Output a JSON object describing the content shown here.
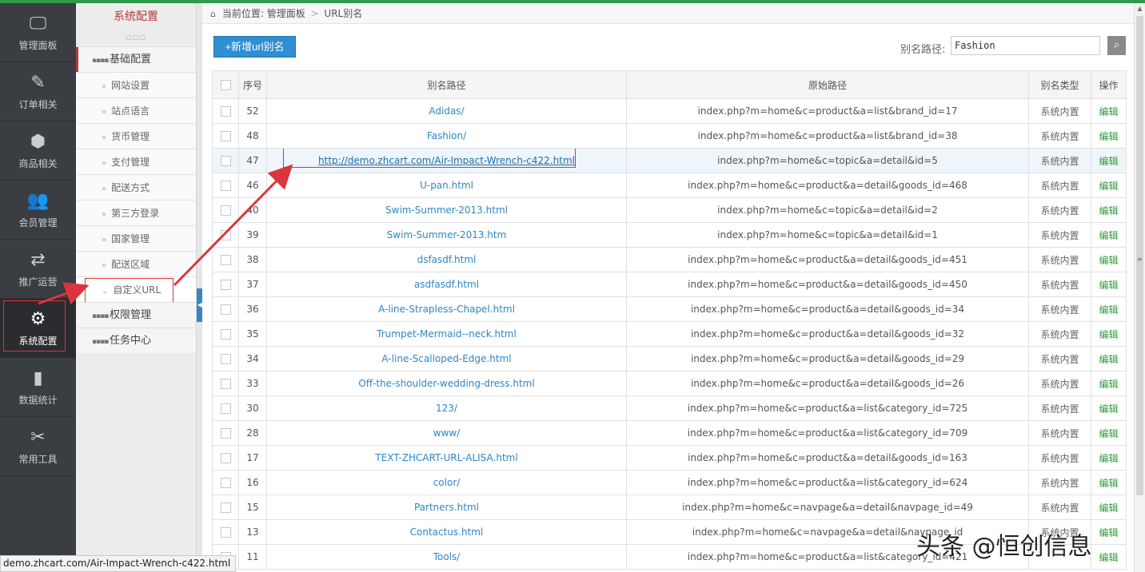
{
  "leftnav": {
    "items": [
      {
        "label": "管理面板",
        "icon": "monitor-icon",
        "glyph": "🖵"
      },
      {
        "label": "订单相关",
        "icon": "edit-icon",
        "glyph": "✎"
      },
      {
        "label": "商品相关",
        "icon": "cube-icon",
        "glyph": "⬢"
      },
      {
        "label": "会员管理",
        "icon": "users-icon",
        "glyph": "👥"
      },
      {
        "label": "推广运营",
        "icon": "retweet-icon",
        "glyph": "⇄"
      },
      {
        "label": "系统配置",
        "icon": "gear-icon",
        "glyph": "⚙"
      },
      {
        "label": "数据统计",
        "icon": "bar-chart-icon",
        "glyph": "▮"
      },
      {
        "label": "常用工具",
        "icon": "wrench-icon",
        "glyph": "✂"
      }
    ],
    "active_index": 5
  },
  "submenu": {
    "title": "系统配置",
    "groups": [
      {
        "label": "基础配置",
        "active": true,
        "items": [
          "网站设置",
          "站点语言",
          "货币管理",
          "支付管理",
          "配送方式",
          "第三方登录",
          "国家管理",
          "配送区域",
          "自定义URL"
        ]
      },
      {
        "label": "权限管理"
      },
      {
        "label": "任务中心"
      }
    ]
  },
  "breadcrumb": {
    "prefix": "当前位置:",
    "level1": "管理面板",
    "sep": ">",
    "level2": "URL别名"
  },
  "toolbar": {
    "add_label": "+新增url别名",
    "search_label": "别名路径:",
    "search_value": "Fashion"
  },
  "table": {
    "headers": [
      "序号",
      "别名路径",
      "原始路径",
      "别名类型",
      "操作"
    ],
    "rows": [
      {
        "id": "52",
        "alias": "Adidas/",
        "orig": "index.php?m=home&c=product&a=list&brand_id=17",
        "type": "系统内置",
        "op": "编辑"
      },
      {
        "id": "48",
        "alias": "Fashion/",
        "orig": "index.php?m=home&c=product&a=list&brand_id=38",
        "type": "系统内置",
        "op": "编辑"
      },
      {
        "id": "47",
        "alias": "http://demo.zhcart.com/Air-Impact-Wrench-c422.html",
        "orig": "index.php?m=home&c=topic&a=detail&id=5",
        "type": "系统内置",
        "op": "编辑"
      },
      {
        "id": "46",
        "alias": "U-pan.html",
        "orig": "index.php?m=home&c=product&a=detail&goods_id=468",
        "type": "系统内置",
        "op": "编辑"
      },
      {
        "id": "40",
        "alias": "Swim-Summer-2013.html",
        "orig": "index.php?m=home&c=topic&a=detail&id=2",
        "type": "系统内置",
        "op": "编辑"
      },
      {
        "id": "39",
        "alias": "Swim-Summer-2013.htm",
        "orig": "index.php?m=home&c=topic&a=detail&id=1",
        "type": "系统内置",
        "op": "编辑"
      },
      {
        "id": "38",
        "alias": "dsfasdf.html",
        "orig": "index.php?m=home&c=product&a=detail&goods_id=451",
        "type": "系统内置",
        "op": "编辑"
      },
      {
        "id": "37",
        "alias": "asdfasdf.html",
        "orig": "index.php?m=home&c=product&a=detail&goods_id=450",
        "type": "系统内置",
        "op": "编辑"
      },
      {
        "id": "36",
        "alias": "A-line-Strapless-Chapel.html",
        "orig": "index.php?m=home&c=product&a=detail&goods_id=34",
        "type": "系统内置",
        "op": "编辑"
      },
      {
        "id": "35",
        "alias": "Trumpet-Mermaid--neck.html",
        "orig": "index.php?m=home&c=product&a=detail&goods_id=32",
        "type": "系统内置",
        "op": "编辑"
      },
      {
        "id": "34",
        "alias": "A-line-Scalloped-Edge.html",
        "orig": "index.php?m=home&c=product&a=detail&goods_id=29",
        "type": "系统内置",
        "op": "编辑"
      },
      {
        "id": "33",
        "alias": "Off-the-shoulder-wedding-dress.html",
        "orig": "index.php?m=home&c=product&a=detail&goods_id=26",
        "type": "系统内置",
        "op": "编辑"
      },
      {
        "id": "30",
        "alias": "123/",
        "orig": "index.php?m=home&c=product&a=list&category_id=725",
        "type": "系统内置",
        "op": "编辑"
      },
      {
        "id": "28",
        "alias": "www/",
        "orig": "index.php?m=home&c=product&a=list&category_id=709",
        "type": "系统内置",
        "op": "编辑"
      },
      {
        "id": "17",
        "alias": "TEXT-ZHCART-URL-ALISA.html",
        "orig": "index.php?m=home&c=product&a=detail&goods_id=163",
        "type": "系统内置",
        "op": "编辑"
      },
      {
        "id": "16",
        "alias": "color/",
        "orig": "index.php?m=home&c=product&a=list&category_id=624",
        "type": "系统内置",
        "op": "编辑"
      },
      {
        "id": "15",
        "alias": "Partners.html",
        "orig": "index.php?m=home&c=navpage&a=detail&navpage_id=49",
        "type": "系统内置",
        "op": "编辑"
      },
      {
        "id": "13",
        "alias": "Contactus.html",
        "orig": "index.php?m=home&c=navpage&a=detail&navpage_id",
        "type": "系统内置",
        "op": "编辑"
      },
      {
        "id": "11",
        "alias": "Tools/",
        "orig": "index.php?m=home&c=product&a=list&category_id=421",
        "type": "",
        "op": "编辑"
      }
    ],
    "hover_row_index": 2
  },
  "statusbar": {
    "url": "demo.zhcart.com/Air-Impact-Wrench-c422.html"
  },
  "watermark": {
    "text": "头条 @恒创信息"
  },
  "colors": {
    "accent": "#2e8fd2",
    "brand_green": "#2e9a4a",
    "highlight_red": "#d9363e",
    "link_blue": "#2f86c6"
  }
}
